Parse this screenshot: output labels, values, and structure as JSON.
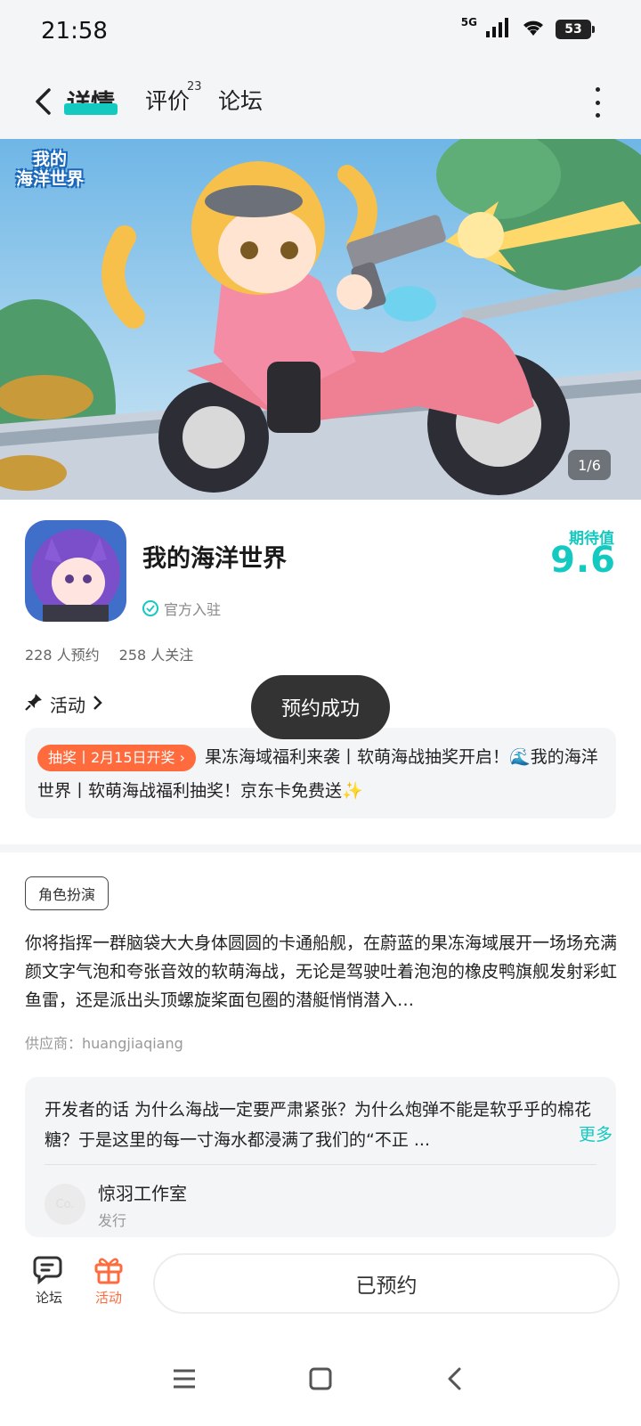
{
  "status_bar": {
    "time": "21:58",
    "network": "5G",
    "battery": "53"
  },
  "header": {
    "tabs": [
      {
        "label": "详情",
        "active": true
      },
      {
        "label": "评价",
        "count": "23"
      },
      {
        "label": "论坛"
      }
    ]
  },
  "banner": {
    "logo_line1": "我的",
    "logo_line2": "海洋世界",
    "counter": "1/6"
  },
  "game": {
    "title": "我的海洋世界",
    "official_label": "官方入驻",
    "expect_label": "期待值",
    "expect_score": "9.6",
    "reservations": "228 人预约",
    "followers": "258 人关注"
  },
  "activity": {
    "heading": "活动",
    "badge": "抽奖丨2月15日开奖",
    "text": "果冻海域福利来袭丨软萌海战抽奖开启！🌊我的海洋世界丨软萌海战福利抽奖！京东卡免费送✨"
  },
  "toast": "预约成功",
  "details": {
    "genre_tag": "角色扮演",
    "description": "你将指挥一群脑袋大大身体圆圆的卡通船舰，在蔚蓝的果冻海域展开一场场充满颜文字气泡和夸张音效的软萌海战，无论是驾驶吐着泡泡的橡皮鸭旗舰发射彩虹鱼雷，还是派出头顶螺旋桨面包圈的潜艇悄悄潜入…",
    "provider": "供应商：huangjiaqiang"
  },
  "developer": {
    "note": "开发者的话  为什么海战一定要严肃紧张？为什么炮弹不能是软乎乎的棉花糖？于是这里的每一寸海水都浸满了我们的“不正 ...",
    "more": "更多",
    "avatar_text": "Co.",
    "studio": "惊羽工作室",
    "role": "发行"
  },
  "bottom_bar": {
    "forum": "论坛",
    "activity": "活动",
    "reserved": "已预约"
  },
  "colors": {
    "accent": "#14c9c0",
    "orange": "#ff6b3d",
    "toast_bg": "#333333"
  }
}
